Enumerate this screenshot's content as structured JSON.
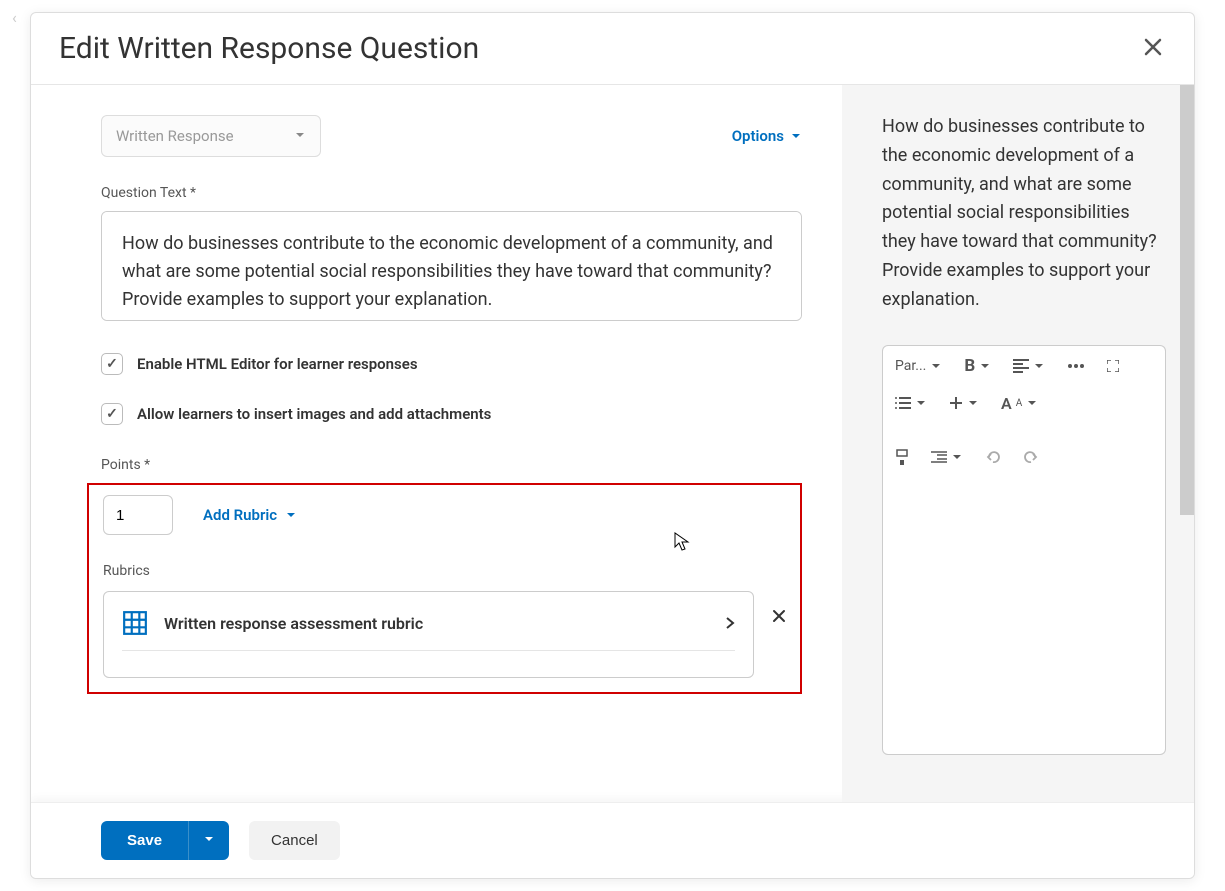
{
  "modal": {
    "title": "Edit Written Response Question"
  },
  "editor": {
    "qtype_select": "Written Response",
    "options_label": "Options",
    "question_text_label": "Question Text *",
    "question_text": "How do businesses contribute to the economic development of a community, and what are some potential social responsibilities they have toward that community? Provide examples to support your explanation.",
    "enable_html_label": "Enable HTML Editor for learner responses",
    "allow_attachments_label": "Allow learners to insert images and add attachments",
    "points_label": "Points *",
    "points_value": "1",
    "add_rubric_label": "Add Rubric",
    "rubrics_label": "Rubrics",
    "rubric_name": "Written response assessment rubric"
  },
  "footer": {
    "save_label": "Save",
    "cancel_label": "Cancel"
  },
  "preview": {
    "question_text": "How do businesses contribute to the economic development of a community, and what are some potential social responsibilities they have toward that community? Provide examples to support your explanation.",
    "rte": {
      "paragraph": "Par...",
      "bold": "B",
      "font": "A"
    }
  }
}
